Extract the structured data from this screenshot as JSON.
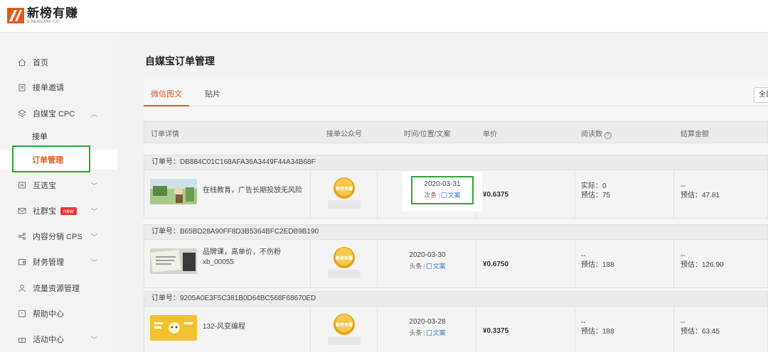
{
  "brand": {
    "title": "新榜有赚",
    "subtitle": "& NEWRANK.CN"
  },
  "sidebar": {
    "items": [
      {
        "label": "首页",
        "icon": "home-icon"
      },
      {
        "label": "接单邀请",
        "icon": "clipboard-icon"
      },
      {
        "label": "自媒宝 CPC",
        "icon": "layers-icon",
        "expanded": true
      },
      {
        "label": "互选宝",
        "icon": "list-icon"
      },
      {
        "label": "社群宝",
        "icon": "envelope-icon",
        "badge": "new"
      },
      {
        "label": "内容分销 CPS",
        "icon": "share-icon"
      },
      {
        "label": "财务管理",
        "icon": "wallet-icon"
      },
      {
        "label": "流量资源管理",
        "icon": "user-icon"
      },
      {
        "label": "帮助中心",
        "icon": "help-icon"
      },
      {
        "label": "活动中心",
        "icon": "gift-icon"
      }
    ],
    "sub_items": [
      {
        "label": "接单"
      },
      {
        "label": "订单管理",
        "active": true
      }
    ]
  },
  "main": {
    "title": "自媒宝订单管理",
    "tabs": [
      {
        "label": "微信图文",
        "active": true
      },
      {
        "label": "贴片"
      }
    ],
    "filter_label": "全部",
    "columns": [
      "订单详情",
      "接单公众号",
      "时间/位置/文案",
      "单价",
      "阅读数",
      "结算金额"
    ]
  },
  "orders": [
    {
      "order_no": "订单号：DB884C01C168AFA36A3449F44A34B68F",
      "title": "在线教育，广告长期投放无风险",
      "avatar_text": "新榜有赚",
      "date": "2020-03-31",
      "position": "次条",
      "copy_link": "文案",
      "price": "¥0.6375",
      "reads_actual": "实际：0",
      "reads_est": "预估：75",
      "settle_actual": "--",
      "settle_est": "预估：47.81"
    },
    {
      "order_no": "订单号：B65BD28A90FF8D3B5364BFC2EDB9B190",
      "title": "品牌课，高单价，不伤粉xb_00055",
      "avatar_text": "新榜有赚",
      "date": "2020-03-30",
      "position": "头条",
      "copy_link": "文案",
      "price": "¥0.6750",
      "reads_actual": "--",
      "reads_est": "预估：188",
      "settle_actual": "--",
      "settle_est": "预估：126.90"
    },
    {
      "order_no": "订单号：9205A0E3F5C381B0D64BC568F68670ED",
      "title": "132-风变编程",
      "avatar_text": "新榜有赚",
      "date": "2020-03-28",
      "position": "头条",
      "copy_link": "文案",
      "price": "¥0.3375",
      "reads_actual": "--",
      "reads_est": "预估：188",
      "settle_actual": "--",
      "settle_est": "预估：63.45"
    }
  ],
  "colors": {
    "accent": "#e05a1c",
    "highlight": "#2ea82e",
    "link": "#3a7bd5",
    "badge": "#e53935"
  }
}
